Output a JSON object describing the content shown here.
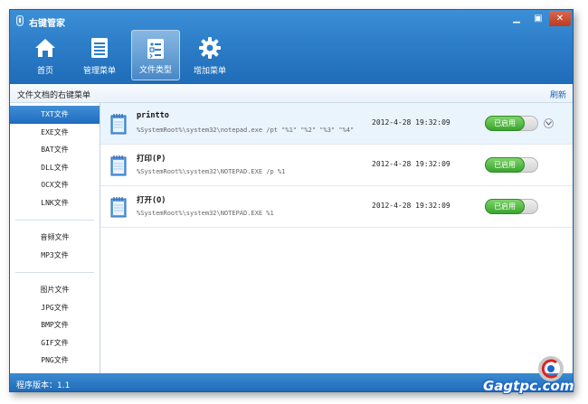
{
  "window": {
    "title": "右键管家"
  },
  "window_controls": {
    "minimize": "▁",
    "maximize": "▣",
    "close": "✕"
  },
  "toolbar": {
    "items": [
      {
        "label": "首页",
        "icon": "home-icon"
      },
      {
        "label": "管理菜单",
        "icon": "menu-list-icon"
      },
      {
        "label": "文件类型",
        "icon": "file-type-icon",
        "active": true
      },
      {
        "label": "增加菜单",
        "icon": "gear-icon"
      }
    ]
  },
  "subheader": {
    "title": "文件文档的右键菜单",
    "refresh": "刷新"
  },
  "sidebar": {
    "groups": [
      [
        "TXT文件",
        "EXE文件",
        "BAT文件",
        "DLL文件",
        "OCX文件",
        "LNK文件"
      ],
      [
        "音频文件",
        "MP3文件"
      ],
      [
        "图片文件",
        "JPG文件",
        "BMP文件",
        "GIF文件",
        "PNG文件"
      ]
    ],
    "selected": "TXT文件"
  },
  "entries": [
    {
      "name": "printto",
      "command": "%SystemRoot%\\system32\\notepad.exe /pt \"%1\" \"%2\" \"%3\" \"%4\"",
      "time": "2012-4-28 19:32:09",
      "status": "已启用"
    },
    {
      "name": "打印(P)",
      "command": "%SystemRoot%\\system32\\NOTEPAD.EXE /p %1",
      "time": "2012-4-28 19:32:09",
      "status": "已启用"
    },
    {
      "name": "打开(O)",
      "command": "%SystemRoot%\\system32\\NOTEPAD.EXE %1",
      "time": "2012-4-28 19:32:09",
      "status": "已启用"
    }
  ],
  "status": {
    "version": "程序版本：1.1"
  },
  "watermark": {
    "text": "Gagtpc.com"
  },
  "colors": {
    "header": "#2d7ec9",
    "accent": "#1f6cbf",
    "enabled": "#3aa52d"
  }
}
